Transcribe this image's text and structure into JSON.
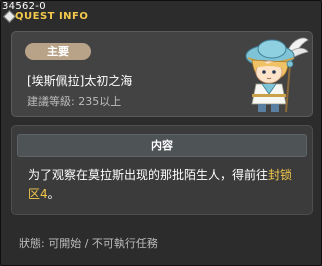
{
  "window": {
    "quest_id": "34562-0",
    "title": "QUEST INFO"
  },
  "quest": {
    "badge": "主要",
    "name": "[埃斯佩拉]太初之海",
    "level_requirement": "建議等級: 235以上"
  },
  "content": {
    "header": "内容",
    "text_before": "为了观察在莫拉斯出现的那批陌生人，得前往",
    "highlight": "封锁区4",
    "text_after": "。"
  },
  "status": {
    "text": "狀態: 可開始 / 不可執行任務"
  },
  "colors": {
    "title": "#f4c94c",
    "highlight": "#f4c94c",
    "badge": "#b8a388"
  }
}
